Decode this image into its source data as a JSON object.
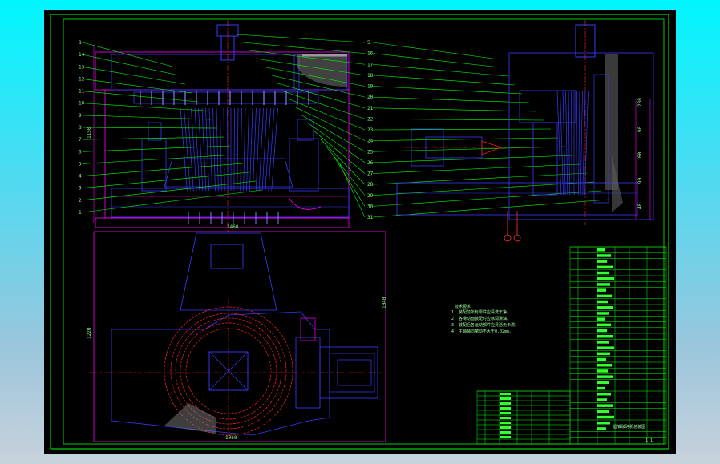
{
  "colors": {
    "background": "#000000",
    "frame": "#00ff00",
    "outline": "#ff00ff",
    "parts": "#3a3aff",
    "leaders": "#00ff00",
    "center": "#ff2020",
    "hatch": "#00ffff",
    "text": "#7fff7f"
  },
  "front_view": {
    "dims": [
      "1150",
      "1460"
    ],
    "part_numbers_left": [
      "8",
      "14",
      "13",
      "12",
      "11",
      "10",
      "9",
      "8",
      "7",
      "6",
      "5",
      "4",
      "3",
      "2",
      "1"
    ],
    "part_numbers_right": [
      "5",
      "16",
      "17",
      "18",
      "19",
      "20",
      "21",
      "22",
      "23",
      "24",
      "25",
      "26",
      "27",
      "28",
      "29",
      "30",
      "31"
    ]
  },
  "side_view": {
    "dims": [
      "280",
      "90",
      "60",
      "90",
      "40"
    ]
  },
  "plan_view": {
    "dims": [
      "1220",
      "1040",
      "1060"
    ]
  },
  "notes": {
    "title": "技术要求",
    "lines": [
      "1. 装配前所有零件应清洗干净。",
      "2. 各滑动面装配时应涂润滑油。",
      "3. 装配后各运动部件应灵活无卡滞。",
      "4. 主轴轴向窜动不大于0.02mm。"
    ]
  },
  "title_block": {
    "drawing_title": "圆锥破碎机总装图",
    "sheet": "1:1"
  }
}
